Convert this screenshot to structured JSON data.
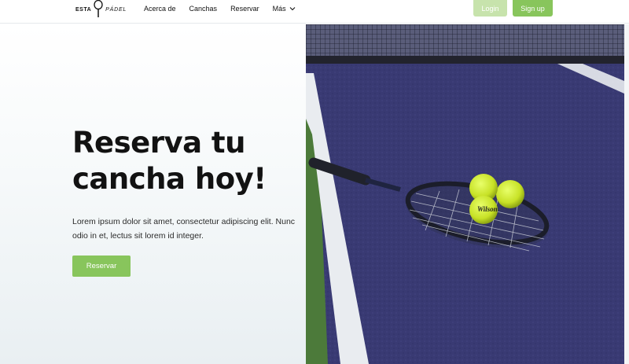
{
  "header": {
    "logo": {
      "left": "ESTA",
      "right": "PÁDEL"
    },
    "nav": [
      {
        "label": "Acerca de"
      },
      {
        "label": "Canchas"
      },
      {
        "label": "Reservar"
      },
      {
        "label": "Más"
      }
    ],
    "login_label": "Login",
    "signup_label": "Sign up"
  },
  "hero": {
    "title_line1": "Reserva tu",
    "title_line2": "cancha hoy!",
    "text": "Lorem ipsum dolor sit amet, consectetur adipiscing elit. Nunc odio in et, lectus sit lorem id integer.",
    "cta_label": "Reservar",
    "ball_brand": "Wilson"
  },
  "colors": {
    "accent": "#88c55c",
    "accent_light": "#c7e3ac",
    "court": "#3d3f78"
  }
}
